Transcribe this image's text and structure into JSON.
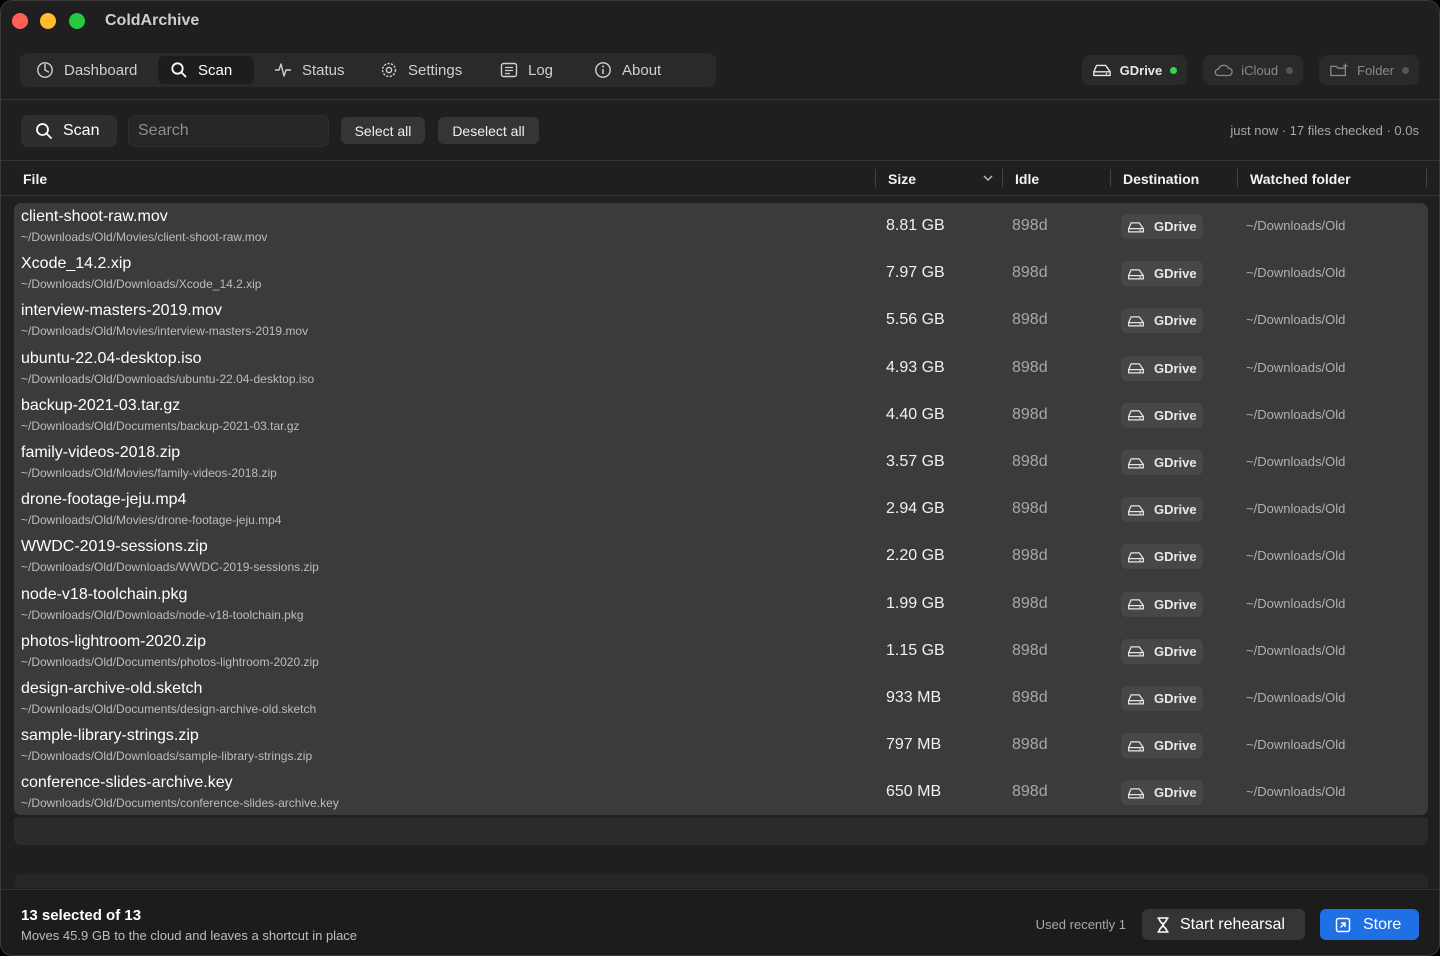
{
  "app": {
    "title": "ColdArchive"
  },
  "nav": {
    "items": [
      {
        "label": "Dashboard",
        "icon": "gauge-icon",
        "active": false
      },
      {
        "label": "Scan",
        "icon": "search-icon",
        "active": true
      },
      {
        "label": "Status",
        "icon": "pulse-icon",
        "active": false
      },
      {
        "label": "Settings",
        "icon": "gear-icon",
        "active": false
      },
      {
        "label": "Log",
        "icon": "list-icon",
        "active": false
      },
      {
        "label": "About",
        "icon": "info-icon",
        "active": false
      }
    ]
  },
  "destinations": [
    {
      "label": "GDrive",
      "icon": "drive-icon",
      "connected": true
    },
    {
      "label": "iCloud",
      "icon": "cloud-icon",
      "connected": false
    },
    {
      "label": "Folder",
      "icon": "folder-plus-icon",
      "connected": false
    }
  ],
  "toolbar": {
    "scan_label": "Scan",
    "search_placeholder": "Search",
    "select_all_label": "Select all",
    "deselect_all_label": "Deselect all",
    "status_text": "just now · 17 files checked · 0.0s"
  },
  "table": {
    "columns": {
      "file": "File",
      "size": "Size",
      "idle": "Idle",
      "destination": "Destination",
      "watched": "Watched folder"
    },
    "rows": [
      {
        "name": "client-shoot-raw.mov",
        "path": "~/Downloads/Old/Movies/client-shoot-raw.mov",
        "size": "8.81 GB",
        "idle": "898d",
        "dest": "GDrive",
        "watched": "~/Downloads/Old"
      },
      {
        "name": "Xcode_14.2.xip",
        "path": "~/Downloads/Old/Downloads/Xcode_14.2.xip",
        "size": "7.97 GB",
        "idle": "898d",
        "dest": "GDrive",
        "watched": "~/Downloads/Old"
      },
      {
        "name": "interview-masters-2019.mov",
        "path": "~/Downloads/Old/Movies/interview-masters-2019.mov",
        "size": "5.56 GB",
        "idle": "898d",
        "dest": "GDrive",
        "watched": "~/Downloads/Old"
      },
      {
        "name": "ubuntu-22.04-desktop.iso",
        "path": "~/Downloads/Old/Downloads/ubuntu-22.04-desktop.iso",
        "size": "4.93 GB",
        "idle": "898d",
        "dest": "GDrive",
        "watched": "~/Downloads/Old"
      },
      {
        "name": "backup-2021-03.tar.gz",
        "path": "~/Downloads/Old/Documents/backup-2021-03.tar.gz",
        "size": "4.40 GB",
        "idle": "898d",
        "dest": "GDrive",
        "watched": "~/Downloads/Old"
      },
      {
        "name": "family-videos-2018.zip",
        "path": "~/Downloads/Old/Movies/family-videos-2018.zip",
        "size": "3.57 GB",
        "idle": "898d",
        "dest": "GDrive",
        "watched": "~/Downloads/Old"
      },
      {
        "name": "drone-footage-jeju.mp4",
        "path": "~/Downloads/Old/Movies/drone-footage-jeju.mp4",
        "size": "2.94 GB",
        "idle": "898d",
        "dest": "GDrive",
        "watched": "~/Downloads/Old"
      },
      {
        "name": "WWDC-2019-sessions.zip",
        "path": "~/Downloads/Old/Downloads/WWDC-2019-sessions.zip",
        "size": "2.20 GB",
        "idle": "898d",
        "dest": "GDrive",
        "watched": "~/Downloads/Old"
      },
      {
        "name": "node-v18-toolchain.pkg",
        "path": "~/Downloads/Old/Downloads/node-v18-toolchain.pkg",
        "size": "1.99 GB",
        "idle": "898d",
        "dest": "GDrive",
        "watched": "~/Downloads/Old"
      },
      {
        "name": "photos-lightroom-2020.zip",
        "path": "~/Downloads/Old/Documents/photos-lightroom-2020.zip",
        "size": "1.15 GB",
        "idle": "898d",
        "dest": "GDrive",
        "watched": "~/Downloads/Old"
      },
      {
        "name": "design-archive-old.sketch",
        "path": "~/Downloads/Old/Documents/design-archive-old.sketch",
        "size": "933 MB",
        "idle": "898d",
        "dest": "GDrive",
        "watched": "~/Downloads/Old"
      },
      {
        "name": "sample-library-strings.zip",
        "path": "~/Downloads/Old/Downloads/sample-library-strings.zip",
        "size": "797 MB",
        "idle": "898d",
        "dest": "GDrive",
        "watched": "~/Downloads/Old"
      },
      {
        "name": "conference-slides-archive.key",
        "path": "~/Downloads/Old/Documents/conference-slides-archive.key",
        "size": "650 MB",
        "idle": "898d",
        "dest": "GDrive",
        "watched": "~/Downloads/Old"
      }
    ]
  },
  "footer": {
    "selected_text": "13 selected of 13",
    "description": "Moves 45.9 GB to the cloud and leaves a shortcut in place",
    "used_recently": "Used recently 1",
    "rehearsal_label": "Start rehearsal",
    "store_label": "Store"
  },
  "colors": {
    "accent": "#1f6fe5",
    "connected": "#32d74b"
  }
}
